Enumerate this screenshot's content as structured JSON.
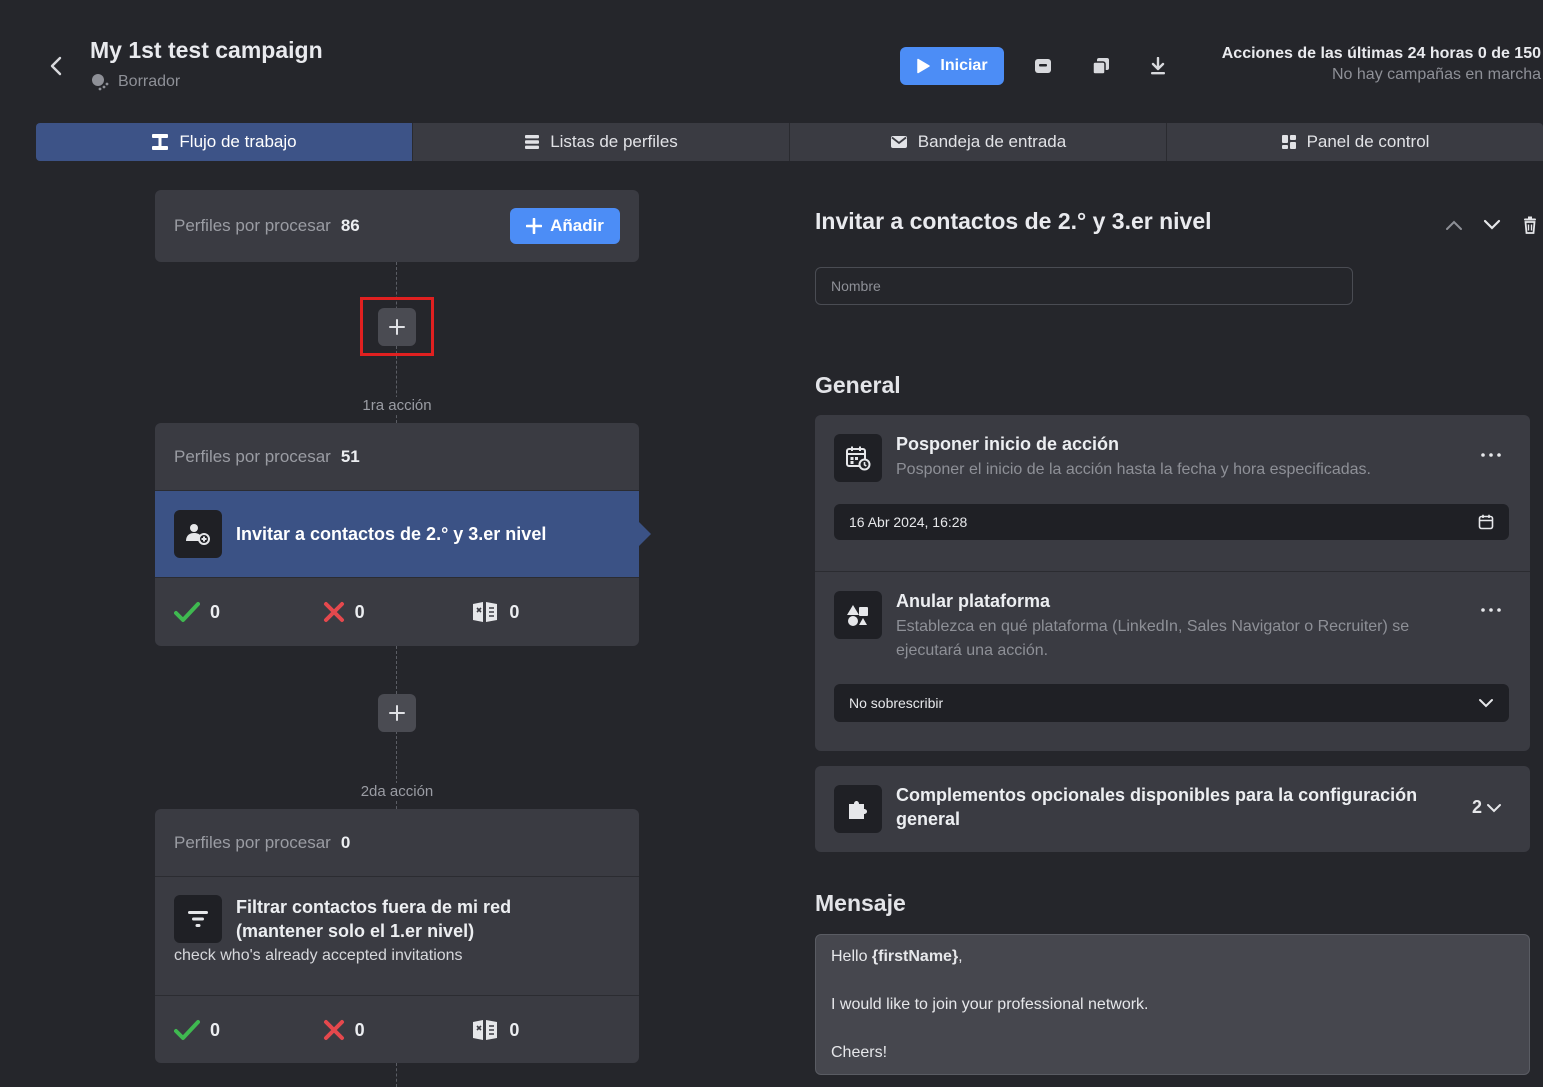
{
  "header": {
    "title": "My 1st test campaign",
    "status": "Borrador",
    "start_label": "Iniciar",
    "quota_line1": "Acciones de las últimas 24 horas 0 de 150",
    "quota_line2": "No hay campañas en marcha"
  },
  "tabs": [
    {
      "label": "Flujo de trabajo",
      "icon": "workflow-icon",
      "active": true
    },
    {
      "label": "Listas de perfiles",
      "icon": "list-icon",
      "active": false
    },
    {
      "label": "Bandeja de entrada",
      "icon": "mail-icon",
      "active": false
    },
    {
      "label": "Panel de control",
      "icon": "dashboard-icon",
      "active": false
    }
  ],
  "workflow": {
    "start": {
      "label": "Perfiles por procesar",
      "count": "86",
      "add_label": "Añadir"
    },
    "step1": {
      "step_label": "1ra acción",
      "pending_label": "Perfiles por procesar",
      "pending_count": "51",
      "title": "Invitar a contactos de 2.° y 3.er nivel",
      "success": "0",
      "failed": "0",
      "skipped": "0"
    },
    "step2": {
      "step_label": "2da acción",
      "pending_label": "Perfiles por procesar",
      "pending_count": "0",
      "title_line1": "Filtrar contactos fuera de mi red",
      "title_line2": "(mantener solo el 1.er nivel)",
      "note": "check who's already accepted invitations",
      "success": "0",
      "failed": "0",
      "skipped": "0"
    }
  },
  "panel": {
    "title": "Invitar a contactos de 2.° y 3.er nivel",
    "name_placeholder": "Nombre",
    "general_heading": "General",
    "postpone": {
      "title": "Posponer inicio de acción",
      "desc": "Posponer el inicio de la acción hasta la fecha y hora especificadas.",
      "value": "16 Abr 2024, 16:28"
    },
    "platform": {
      "title": "Anular plataforma",
      "desc_line1": "Establezca en qué plataforma (LinkedIn, Sales Navigator o Recruiter) se",
      "desc_line2": "ejecutará una acción.",
      "value": "No sobrescribir"
    },
    "addons": {
      "title_line1": "Complementos opcionales disponibles para la configuración",
      "title_line2": "general",
      "count": "2"
    },
    "message_heading": "Mensaje",
    "message": {
      "greeting_prefix": "Hello ",
      "variable": "{firstName}",
      "greeting_suffix": ",",
      "body": "I would like to join your professional network.",
      "signoff": "Cheers!"
    }
  },
  "colors": {
    "background": "#25262b",
    "card": "#3a3b42",
    "accent": "#4c8df6",
    "selected": "#3b5285",
    "success": "#3fb950",
    "failed": "#e5484d",
    "highlight": "#e02020"
  }
}
